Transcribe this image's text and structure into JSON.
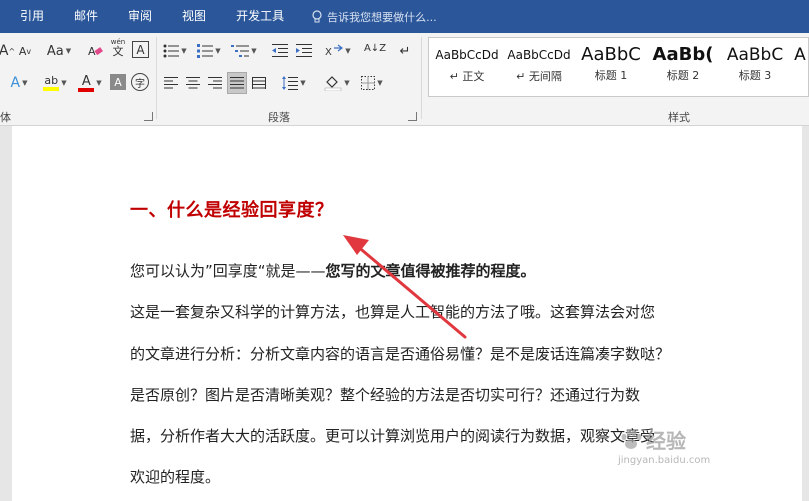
{
  "tabs": [
    "引用",
    "邮件",
    "审阅",
    "视图",
    "开发工具"
  ],
  "tell_me": "告诉我您想要做什么...",
  "ribbon": {
    "font_group_label": "体",
    "paragraph_group_label": "段落",
    "styles_group_label": "样式",
    "font_size_grow": "A",
    "font_size_shrink": "A",
    "change_case": "Aa",
    "phonetic_guide_top": "wén",
    "phonetic_guide_bottom": "文",
    "char_border": "A",
    "text_effects": "A",
    "highlight": "ab",
    "font_color": "A",
    "char_shading": "A",
    "enclose_char": "字",
    "sort": "A↓Z"
  },
  "styles": [
    {
      "sample": "AaBbCcDd",
      "name": "正文"
    },
    {
      "sample": "AaBbCcDd",
      "name": "无间隔"
    },
    {
      "sample": "AaBbC",
      "name": "标题 1"
    },
    {
      "sample": "AaBb(",
      "name": "标题 2"
    },
    {
      "sample": "AaBbC",
      "name": "标题 3"
    }
  ],
  "document": {
    "heading": "一、什么是经验回享度？",
    "para1_normal": "您可以认为”回享度“就是——",
    "para1_bold": "您写的文章值得被推荐的程度。",
    "lines": [
      "这是一套复杂又科学的计算方法，也算是人工智能的方法了哦。这套算法会对您",
      "的文章进行分析：分析文章内容的语言是否通俗易懂？是不是废话连篇凑字数哒？",
      "是否原创？图片是否清晰美观？整个经验的方法是否切实可行？还通过行为数",
      "据，分析作者大大的活跃度。更可以计算浏览用户的阅读行为数据，观察文章受",
      "欢迎的程度。"
    ]
  },
  "watermark": {
    "brand": "经验",
    "url": "jingyan.baidu.com"
  },
  "colors": {
    "tab_bar": "#2b579a",
    "heading": "#c00000",
    "arrow": "#e0383e"
  }
}
